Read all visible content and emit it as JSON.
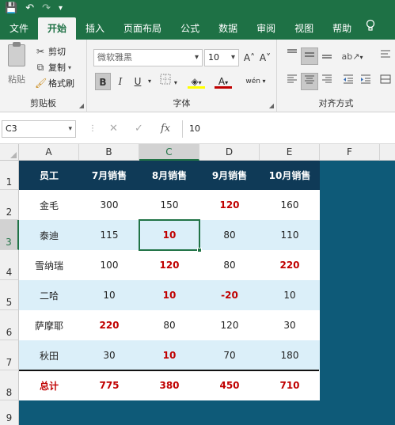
{
  "titlebar": {
    "save_icon": "💾",
    "undo_icon": "↶",
    "redo_icon": "↷",
    "customize_icon": "▾"
  },
  "tabs": [
    "文件",
    "开始",
    "插入",
    "页面布局",
    "公式",
    "数据",
    "审阅",
    "视图",
    "帮助"
  ],
  "active_tab": "开始",
  "tell_me_icon": "lightbulb-icon",
  "clipboard": {
    "paste_label": "粘贴",
    "cut_label": "剪切",
    "copy_label": "复制",
    "format_painter_label": "格式刷",
    "group_label": "剪贴板"
  },
  "font": {
    "font_name": "微软雅黑",
    "font_size": "10",
    "bold": "B",
    "italic": "I",
    "underline": "U",
    "grow": "A˄",
    "shrink": "A˅",
    "font_color_letter": "A",
    "phonetic": "wén",
    "group_label": "字体",
    "fill_color": "#ffff00",
    "font_color": "#c00000"
  },
  "alignment": {
    "group_label": "对齐方式"
  },
  "formula_bar": {
    "name_box": "C3",
    "cancel_icon": "✕",
    "enter_icon": "✓",
    "fx_label": "fx",
    "value": "10"
  },
  "columns": [
    "A",
    "B",
    "C",
    "D",
    "E",
    "F"
  ],
  "rows": [
    "1",
    "2",
    "3",
    "4",
    "5",
    "6",
    "7",
    "8",
    "9"
  ],
  "selected_cell": "C3",
  "table": {
    "headers": [
      "员工",
      "7月销售",
      "8月销售",
      "9月销售",
      "10月销售"
    ],
    "rows": [
      {
        "name": "金毛",
        "values": [
          "300",
          "150",
          "120",
          "160"
        ],
        "red": [
          false,
          false,
          true,
          false
        ]
      },
      {
        "name": "泰迪",
        "values": [
          "115",
          "10",
          "80",
          "110"
        ],
        "red": [
          false,
          true,
          false,
          false
        ]
      },
      {
        "name": "雪纳瑞",
        "values": [
          "100",
          "120",
          "80",
          "220"
        ],
        "red": [
          false,
          true,
          false,
          true
        ]
      },
      {
        "name": "二哈",
        "values": [
          "10",
          "10",
          "-20",
          "10"
        ],
        "red": [
          false,
          true,
          true,
          false
        ]
      },
      {
        "name": "萨摩耶",
        "values": [
          "220",
          "80",
          "120",
          "30"
        ],
        "red": [
          true,
          false,
          false,
          false
        ]
      },
      {
        "name": "秋田",
        "values": [
          "30",
          "10",
          "70",
          "180"
        ],
        "red": [
          false,
          true,
          false,
          false
        ]
      }
    ],
    "total": {
      "name": "总计",
      "values": [
        "775",
        "380",
        "450",
        "710"
      ]
    }
  }
}
